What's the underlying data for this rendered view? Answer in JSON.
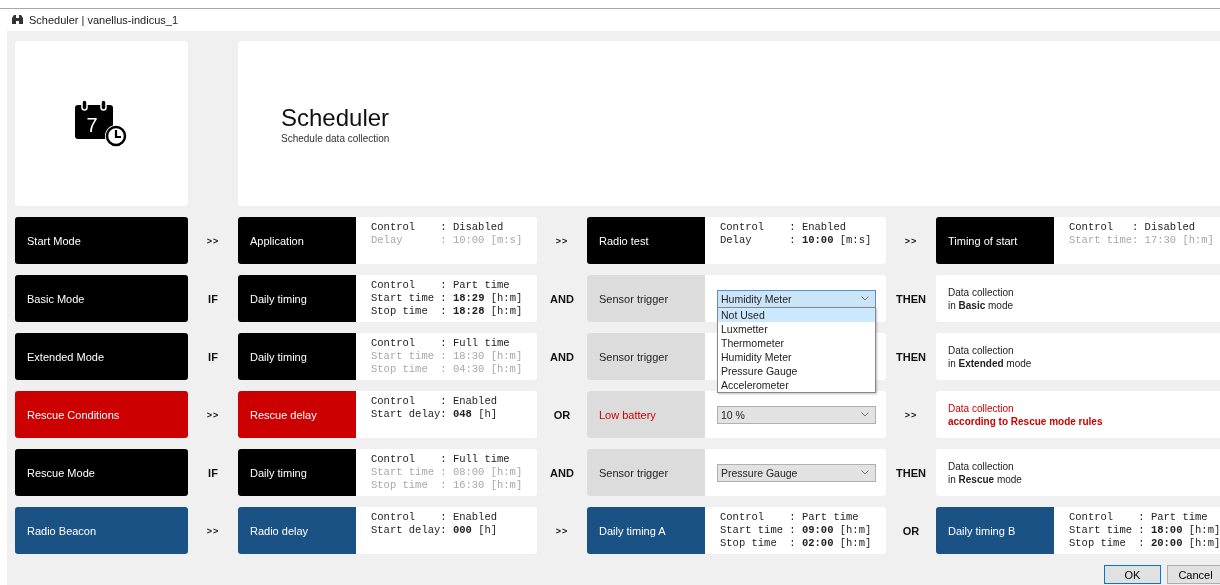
{
  "window": {
    "title": "Scheduler | vanellus-indicus_1"
  },
  "header": {
    "icon_label": "7",
    "title": "Scheduler",
    "subtitle": "Schedule data collection"
  },
  "rows": [
    {
      "mode": {
        "label": "Start Mode",
        "color": "#000000"
      },
      "steps": [
        {
          "connector": ">>",
          "block": {
            "kind": "info",
            "label": "Application",
            "color": "#000000",
            "lines": [
              {
                "text": "Control    : Disabled",
                "dimmed": false
              },
              {
                "text": "Delay      : 10:00 [m:s]",
                "dimmed": true
              }
            ]
          }
        },
        {
          "connector": ">>",
          "block": {
            "kind": "info",
            "label": "Radio test",
            "color": "#000000",
            "lines": [
              {
                "text": "Control    : Enabled",
                "dimmed": false
              },
              {
                "text": "Delay      : **10:00** [m:s]",
                "dimmed": false
              }
            ]
          }
        },
        {
          "connector": ">>",
          "block": {
            "kind": "info",
            "label": "Timing of start",
            "color": "#000000",
            "lines": [
              {
                "text": "Control   : Disabled",
                "dimmed": false
              },
              {
                "text": "Start time: 17:30 [h:m]",
                "dimmed": true
              }
            ]
          }
        }
      ]
    },
    {
      "mode": {
        "label": "Basic Mode",
        "color": "#000000"
      },
      "steps": [
        {
          "connector": "IF",
          "block": {
            "kind": "info",
            "label": "Daily timing",
            "color": "#000000",
            "lines": [
              {
                "text": "Control    : Part time",
                "dimmed": false
              },
              {
                "text": "Start time : **18:29** [h:m]",
                "dimmed": false
              },
              {
                "text": "Stop time  : **18:28** [h:m]",
                "dimmed": false
              }
            ]
          }
        },
        {
          "connector": "AND",
          "block": {
            "kind": "select",
            "label": "Sensor trigger",
            "color": "#dcdcdc",
            "warning": false,
            "value": "Humidity Meter",
            "focused": true,
            "open": true,
            "options": [
              {
                "label": "Not Used",
                "highlighted": true
              },
              {
                "label": "Luxmetter",
                "highlighted": false
              },
              {
                "label": "Thermometer",
                "highlighted": false
              },
              {
                "label": "Humidity Meter",
                "highlighted": false
              },
              {
                "label": "Pressure Gauge",
                "highlighted": false
              },
              {
                "label": "Accelerometer",
                "highlighted": false
              }
            ]
          }
        },
        {
          "connector": "THEN",
          "block": {
            "kind": "text",
            "lines": [
              {
                "text": "Data collection",
                "bold": false,
                "warning": false
              },
              {
                "text": "in **Basic** mode",
                "bold": false,
                "warning": false
              }
            ]
          }
        }
      ]
    },
    {
      "mode": {
        "label": "Extended Mode",
        "color": "#000000"
      },
      "steps": [
        {
          "connector": "IF",
          "block": {
            "kind": "info",
            "label": "Daily timing",
            "color": "#000000",
            "lines": [
              {
                "text": "Control    : Full time",
                "dimmed": false
              },
              {
                "text": "Start time : 18:30 [h:m]",
                "dimmed": true
              },
              {
                "text": "Stop time  : 04:30 [h:m]",
                "dimmed": true
              }
            ]
          }
        },
        {
          "connector": "AND",
          "block": {
            "kind": "select",
            "label": "Sensor trigger",
            "color": "#dcdcdc",
            "warning": false
          }
        },
        {
          "connector": "THEN",
          "block": {
            "kind": "text",
            "lines": [
              {
                "text": "Data collection",
                "bold": false,
                "warning": false
              },
              {
                "text": "in **Extended** mode",
                "bold": false,
                "warning": false
              }
            ]
          }
        }
      ]
    },
    {
      "mode": {
        "label": "Rescue Conditions",
        "color": "#cc0000"
      },
      "steps": [
        {
          "connector": ">>",
          "block": {
            "kind": "info",
            "label": "Rescue delay",
            "color": "#cc0000",
            "lines": [
              {
                "text": "Control    : Enabled",
                "dimmed": false
              },
              {
                "text": "Start delay: **048** [h]",
                "dimmed": false
              }
            ]
          }
        },
        {
          "connector": "OR",
          "block": {
            "kind": "select",
            "label": "Low battery",
            "color": "#dcdcdc",
            "warning": true,
            "value": "10 %",
            "focused": false,
            "open": false
          }
        },
        {
          "connector": ">>",
          "block": {
            "kind": "text",
            "lines": [
              {
                "text": "Data collection",
                "bold": false,
                "warning": true
              },
              {
                "text": "according to Rescue mode rules",
                "bold": true,
                "warning": true
              }
            ]
          }
        }
      ]
    },
    {
      "mode": {
        "label": "Rescue Mode",
        "color": "#000000"
      },
      "steps": [
        {
          "connector": "IF",
          "block": {
            "kind": "info",
            "label": "Daily timing",
            "color": "#000000",
            "lines": [
              {
                "text": "Control    : Full time",
                "dimmed": false
              },
              {
                "text": "Start time : 08:00 [h:m]",
                "dimmed": true
              },
              {
                "text": "Stop time  : 16:30 [h:m]",
                "dimmed": true
              }
            ]
          }
        },
        {
          "connector": "AND",
          "block": {
            "kind": "select",
            "label": "Sensor trigger",
            "color": "#dcdcdc",
            "warning": false,
            "value": "Pressure Gauge",
            "focused": false,
            "open": false
          }
        },
        {
          "connector": "THEN",
          "block": {
            "kind": "text",
            "lines": [
              {
                "text": "Data collection",
                "bold": false,
                "warning": false
              },
              {
                "text": "in **Rescue** mode",
                "bold": false,
                "warning": false
              }
            ]
          }
        }
      ]
    },
    {
      "mode": {
        "label": "Radio Beacon",
        "color": "#1a5286"
      },
      "steps": [
        {
          "connector": ">>",
          "block": {
            "kind": "info",
            "label": "Radio delay",
            "color": "#1a5286",
            "lines": [
              {
                "text": "Control    : Enabled",
                "dimmed": false
              },
              {
                "text": "Start delay: **000** [h]",
                "dimmed": false
              }
            ]
          }
        },
        {
          "connector": ">>",
          "block": {
            "kind": "info",
            "label": "Daily timing A",
            "color": "#1a5286",
            "lines": [
              {
                "text": "Control    : Part time",
                "dimmed": false
              },
              {
                "text": "Start time : **09:00** [h:m]",
                "dimmed": false
              },
              {
                "text": "Stop time  : **02:00** [h:m]",
                "dimmed": false
              }
            ]
          }
        },
        {
          "connector": "OR",
          "block": {
            "kind": "info",
            "label": "Daily timing B",
            "color": "#1a5286",
            "lines": [
              {
                "text": "Control    : Part time",
                "dimmed": false
              },
              {
                "text": "Start time : **18:00** [h:m]",
                "dimmed": false
              },
              {
                "text": "Stop time  : **20:00** [h:m]",
                "dimmed": false
              }
            ]
          }
        }
      ]
    }
  ],
  "buttons": [
    {
      "label": "OK",
      "default": true
    },
    {
      "label": "Cancel",
      "default": false
    }
  ]
}
